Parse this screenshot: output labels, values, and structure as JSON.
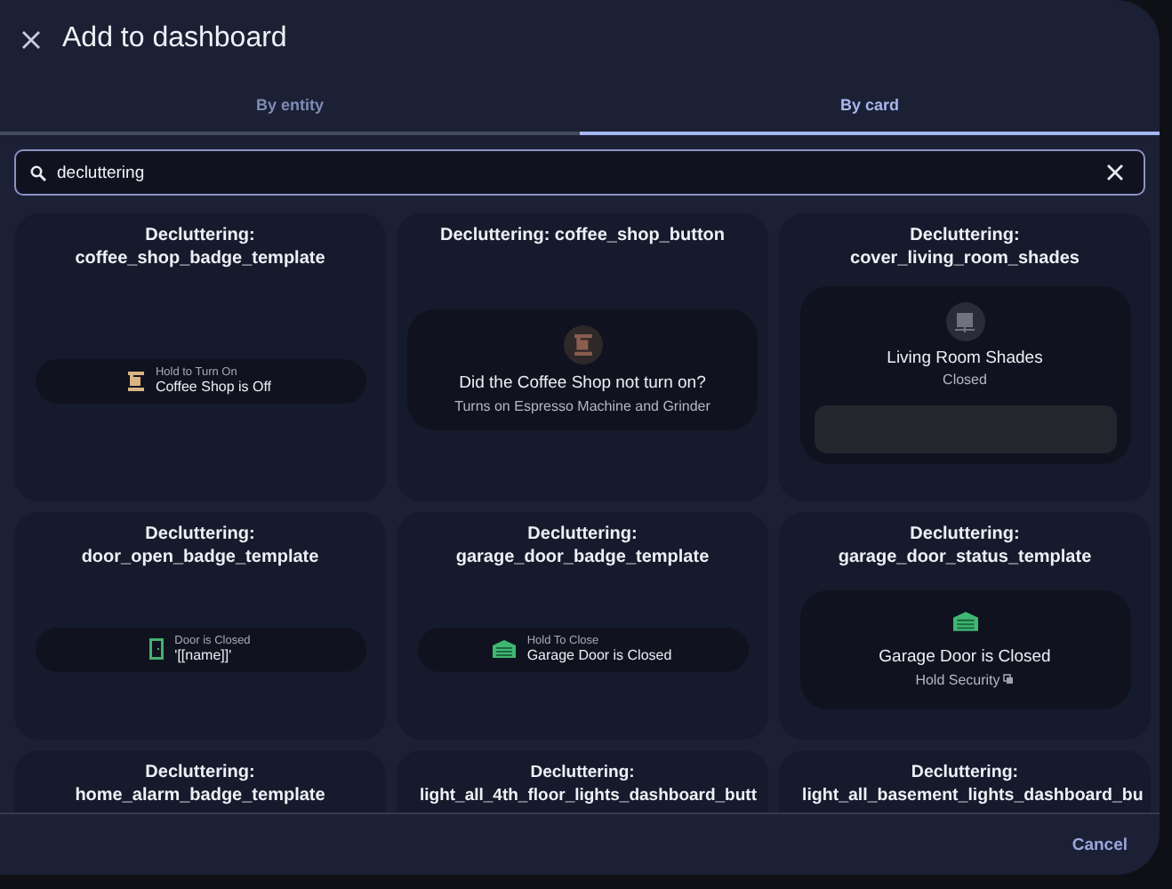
{
  "dialog": {
    "title": "Add to dashboard"
  },
  "tabs": [
    {
      "label": "By entity",
      "selected": false
    },
    {
      "label": "By card",
      "selected": true
    }
  ],
  "search": {
    "value": "decluttering"
  },
  "cards": [
    {
      "title": "Decluttering: coffee_shop_badge_template",
      "preview": {
        "kind": "badge",
        "label": "Hold to Turn On",
        "name": "Coffee Shop is Off"
      }
    },
    {
      "title": "Decluttering: coffee_shop_button",
      "preview": {
        "kind": "button",
        "name": "Did the Coffee Shop not turn on?",
        "subtitle": "Turns on Espresso Machine and Grinder"
      }
    },
    {
      "title": "Decluttering: cover_living_room_shades",
      "preview": {
        "kind": "cover",
        "name": "Living Room Shades",
        "state": "Closed"
      }
    },
    {
      "title": "Decluttering: door_open_badge_template",
      "preview": {
        "kind": "badge",
        "label": "Door is Closed",
        "name": "'[[name]]'"
      }
    },
    {
      "title": "Decluttering: garage_door_badge_template",
      "preview": {
        "kind": "badge",
        "label": "Hold To Close",
        "name": "Garage Door is Closed"
      }
    },
    {
      "title": "Decluttering: garage_door_status_template",
      "preview": {
        "kind": "status",
        "name": "Garage Door is Closed",
        "secondary": "Hold Security"
      }
    },
    {
      "title": "Decluttering: home_alarm_badge_template"
    },
    {
      "title": "Decluttering: light_all_4th_floor_lights_dashboard_butt"
    },
    {
      "title": "Decluttering: light_all_basement_lights_dashboard_bu"
    }
  ],
  "footer": {
    "cancel": "Cancel"
  }
}
